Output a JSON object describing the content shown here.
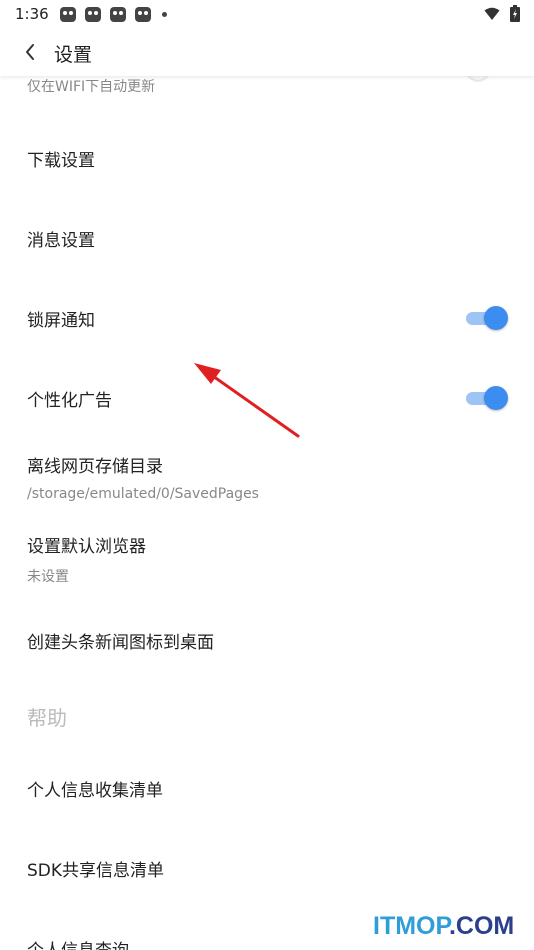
{
  "status_bar": {
    "time": "1:36",
    "notification_icons": [
      "app-notification-icon",
      "app-notification-icon",
      "app-notification-icon",
      "app-notification-icon"
    ],
    "right_icons": [
      "wifi-icon",
      "battery-icon"
    ]
  },
  "header": {
    "back_icon": "chevron-left-icon",
    "title": "设置"
  },
  "settings": {
    "auto_update_wifi": {
      "label": "仅在WIFI下自动更新",
      "toggle_on": false
    },
    "download_settings": {
      "label": "下载设置"
    },
    "message_settings": {
      "label": "消息设置"
    },
    "lockscreen_notify": {
      "label": "锁屏通知",
      "toggle_on": true
    },
    "personalized_ads": {
      "label": "个性化广告",
      "toggle_on": true
    },
    "offline_dir": {
      "label": "离线网页存储目录",
      "value": "/storage/emulated/0/SavedPages"
    },
    "default_browser": {
      "label": "设置默认浏览器",
      "value": "未设置"
    },
    "desktop_shortcut": {
      "label": "创建头条新闻图标到桌面"
    }
  },
  "help_section": {
    "title": "帮助",
    "items": [
      {
        "label": "个人信息收集清单"
      },
      {
        "label": "SDK共享信息清单"
      },
      {
        "label": "个人信息查询"
      }
    ]
  },
  "annotation": {
    "color": "#e02020"
  },
  "watermark": {
    "part1": "ITMOP",
    "part2": ".COM"
  },
  "colors": {
    "toggle_on_thumb": "#3d8cf0",
    "toggle_on_track": "#9ec3f5",
    "section_title": "#bbbbbb"
  }
}
